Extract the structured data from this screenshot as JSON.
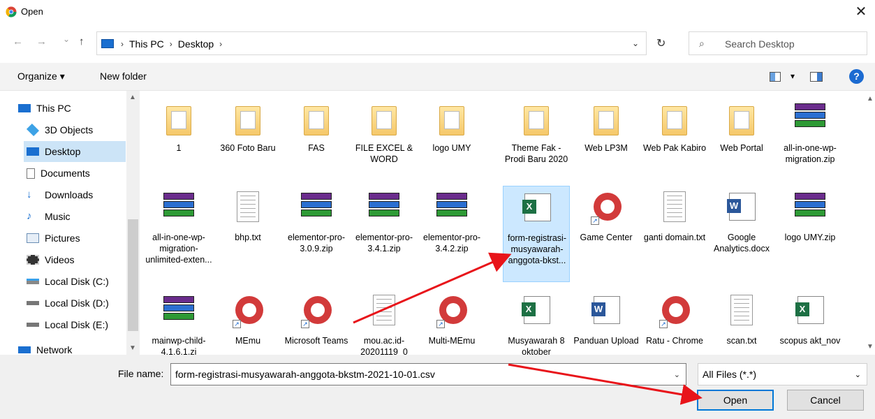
{
  "window": {
    "title": "Open",
    "close_glyph": "✕"
  },
  "nav": {
    "back": "←",
    "forward": "→",
    "recent": "⌄",
    "up": "↑",
    "breadcrumb": [
      "This PC",
      "Desktop"
    ],
    "separator": "›",
    "refresh": "↻"
  },
  "search": {
    "placeholder": "Search Desktop"
  },
  "toolbar": {
    "organize": "Organize ▾",
    "new_folder": "New folder",
    "view_dd": "▾",
    "help": "?"
  },
  "sidebar": {
    "items": [
      {
        "label": "This PC",
        "icon": "pc-icon",
        "selected": false
      },
      {
        "label": "3D Objects",
        "icon": "cube-icon",
        "selected": false
      },
      {
        "label": "Desktop",
        "icon": "desktop-icon",
        "selected": true
      },
      {
        "label": "Documents",
        "icon": "documents-icon",
        "selected": false
      },
      {
        "label": "Downloads",
        "icon": "downloads-icon",
        "selected": false
      },
      {
        "label": "Music",
        "icon": "music-icon",
        "selected": false
      },
      {
        "label": "Pictures",
        "icon": "pictures-icon",
        "selected": false
      },
      {
        "label": "Videos",
        "icon": "videos-icon",
        "selected": false
      },
      {
        "label": "Local Disk (C:)",
        "icon": "drive-icon",
        "selected": false
      },
      {
        "label": "Local Disk (D:)",
        "icon": "drive-icon",
        "selected": false
      },
      {
        "label": "Local Disk (E:)",
        "icon": "drive-icon",
        "selected": false
      },
      {
        "label": "Network",
        "icon": "network-icon",
        "selected": false
      }
    ]
  },
  "files": [
    {
      "label": "1",
      "type": "folder"
    },
    {
      "label": "360 Foto Baru",
      "type": "folder"
    },
    {
      "label": "FAS",
      "type": "folder"
    },
    {
      "label": "FILE EXCEL & WORD",
      "type": "folder"
    },
    {
      "label": "logo UMY",
      "type": "folder"
    },
    {
      "label": "Theme Fak - Prodi Baru 2020",
      "type": "folder"
    },
    {
      "label": "Web LP3M",
      "type": "folder"
    },
    {
      "label": "Web Pak Kabiro",
      "type": "folder"
    },
    {
      "label": "Web Portal",
      "type": "folder"
    },
    {
      "label": "all-in-one-wp-migration.zip",
      "type": "archive"
    },
    {
      "label": "all-in-one-wp-migration-unlimited-exten...",
      "type": "archive"
    },
    {
      "label": "bhp.txt",
      "type": "text"
    },
    {
      "label": "elementor-pro-3.0.9.zip",
      "type": "archive"
    },
    {
      "label": "elementor-pro-3.4.1.zip",
      "type": "archive"
    },
    {
      "label": "elementor-pro-3.4.2.zip",
      "type": "archive"
    },
    {
      "label": "form-registrasi-musyawarah-anggota-bkst...",
      "type": "csv",
      "selected": true
    },
    {
      "label": "Game Center",
      "type": "shortcut-app"
    },
    {
      "label": "ganti domain.txt",
      "type": "text"
    },
    {
      "label": "Google Analytics.docx",
      "type": "word"
    },
    {
      "label": "logo UMY.zip",
      "type": "archive"
    },
    {
      "label": "mainwp-child-4.1.6.1.zi",
      "type": "archive"
    },
    {
      "label": "MEmu",
      "type": "shortcut-app"
    },
    {
      "label": "Microsoft Teams",
      "type": "shortcut-app"
    },
    {
      "label": "mou.ac.id-20201119_0",
      "type": "text"
    },
    {
      "label": "Multi-MEmu",
      "type": "shortcut-app"
    },
    {
      "label": "Musyawarah 8 oktober",
      "type": "excel"
    },
    {
      "label": "Panduan Upload",
      "type": "word"
    },
    {
      "label": "Ratu - Chrome",
      "type": "shortcut-app"
    },
    {
      "label": "scan.txt",
      "type": "text"
    },
    {
      "label": "scopus akt_nov",
      "type": "excel"
    }
  ],
  "footer": {
    "file_name_label": "File name:",
    "file_name_value": "form-registrasi-musyawarah-anggota-bkstm-2021-10-01.csv",
    "file_type": "All Files (*.*)",
    "open_button": "Open",
    "cancel_button": "Cancel",
    "dd_glyph": "⌄"
  },
  "colors": {
    "accent": "#0078d7",
    "selection": "#cce8ff",
    "arrow": "#e8141a"
  }
}
